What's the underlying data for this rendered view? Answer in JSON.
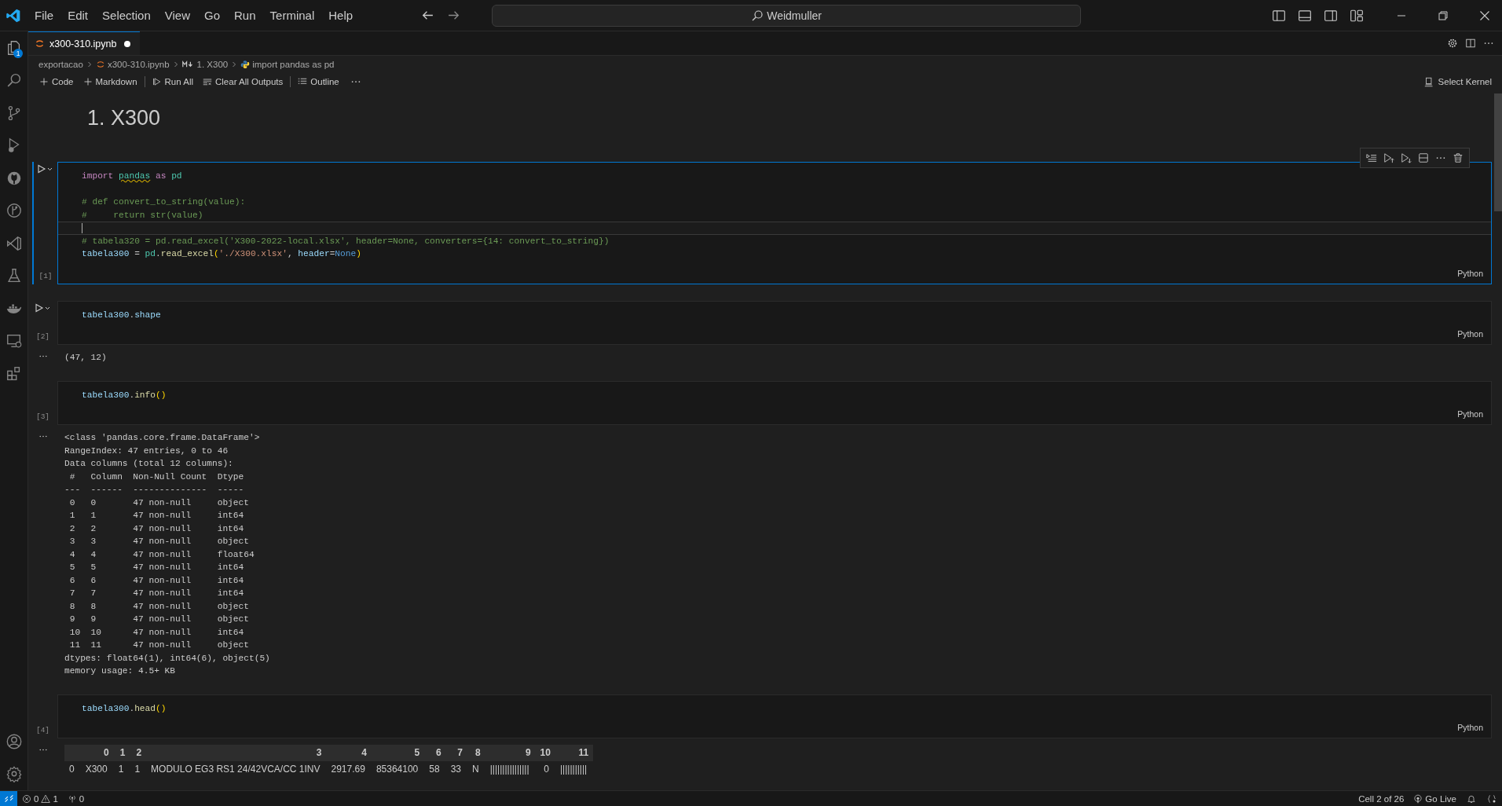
{
  "title_bar": {
    "menu": [
      "File",
      "Edit",
      "Selection",
      "View",
      "Go",
      "Run",
      "Terminal",
      "Help"
    ],
    "command_center": {
      "value": "Weidmuller"
    }
  },
  "activity_bar": {
    "top": [
      {
        "kind": "explorer",
        "badge": "1"
      },
      {
        "kind": "search"
      },
      {
        "kind": "source-control"
      },
      {
        "kind": "run-debug"
      },
      {
        "kind": "circle-logo"
      },
      {
        "kind": "git-graph"
      },
      {
        "kind": "ribbon"
      },
      {
        "kind": "testing"
      },
      {
        "kind": "docker"
      },
      {
        "kind": "remote"
      },
      {
        "kind": "extensions"
      }
    ],
    "bottom": [
      {
        "kind": "account"
      },
      {
        "kind": "manage"
      }
    ]
  },
  "tabs": [
    {
      "label": "x300-310.ipynb",
      "selected": true,
      "modified": true
    }
  ],
  "breadcrumbs": [
    {
      "kind": "folder",
      "label": "exportacao"
    },
    {
      "kind": "notebook",
      "label": "x300-310.ipynb"
    },
    {
      "kind": "markdown",
      "label": "1. X300"
    },
    {
      "kind": "python",
      "label": "import pandas as pd"
    }
  ],
  "notebook_toolbar": [
    {
      "kind": "add",
      "label": "Code"
    },
    {
      "kind": "add",
      "label": "Markdown"
    },
    {
      "kind": "separator"
    },
    {
      "kind": "run-all",
      "label": "Run All"
    },
    {
      "kind": "clear",
      "label": "Clear All Outputs"
    },
    {
      "kind": "separator"
    },
    {
      "kind": "outline",
      "label": "Outline"
    },
    {
      "kind": "more"
    }
  ],
  "kernel": {
    "label": "Select Kernel"
  },
  "heading": "1. X300",
  "cells": [
    {
      "selected": true,
      "run_visible": true,
      "toolbar_visible": true,
      "exec_count": "[1]",
      "language": "Python",
      "lines": [
        {
          "current": false,
          "tokens": [
            {
              "t": "import ",
              "kind": "keyword"
            },
            {
              "t": "pandas",
              "kind": "module-warn"
            },
            {
              "t": " as ",
              "kind": "keyword"
            },
            {
              "t": "pd",
              "kind": "module"
            }
          ]
        },
        {
          "current": false
        },
        {
          "current": false,
          "tokens": [
            {
              "t": "# def convert_to_string(value):",
              "kind": "comment"
            }
          ]
        },
        {
          "current": false,
          "tokens": [
            {
              "t": "#     return str(value)",
              "kind": "comment"
            }
          ]
        },
        {
          "current": true
        },
        {
          "current": false,
          "tokens": [
            {
              "t": "# tabela320 = pd.read_excel('X300-2022-local.xlsx', header=None, converters={14: convert_to_string})",
              "kind": "comment"
            }
          ]
        },
        {
          "current": false,
          "tokens": [
            {
              "t": "tabela300",
              "kind": "var"
            },
            {
              "t": " = ",
              "kind": "plain"
            },
            {
              "t": "pd",
              "kind": "module"
            },
            {
              "t": ".",
              "kind": "plain"
            },
            {
              "t": "read_excel",
              "kind": "func"
            },
            {
              "t": "(",
              "kind": "paren"
            },
            {
              "t": "'./X300.xlsx'",
              "kind": "string"
            },
            {
              "t": ", ",
              "kind": "plain"
            },
            {
              "t": "header",
              "kind": "param"
            },
            {
              "t": "=",
              "kind": "plain"
            },
            {
              "t": "None",
              "kind": "constant"
            },
            {
              "t": ")",
              "kind": "paren"
            }
          ]
        }
      ]
    },
    {
      "selected": false,
      "run_visible": true,
      "toolbar_visible": false,
      "exec_count": "[2]",
      "language": "Python",
      "lines": [
        {
          "current": false,
          "tokens": [
            {
              "t": "tabela300",
              "kind": "var"
            },
            {
              "t": ".",
              "kind": "plain"
            },
            {
              "t": "shape",
              "kind": "var"
            }
          ]
        }
      ],
      "output": {
        "kind": "text",
        "lines": [
          "(47, 12)"
        ]
      }
    },
    {
      "selected": false,
      "run_visible": false,
      "toolbar_visible": false,
      "exec_count": "[3]",
      "language": "Python",
      "lines": [
        {
          "current": false,
          "tokens": [
            {
              "t": "tabela300",
              "kind": "var"
            },
            {
              "t": ".",
              "kind": "plain"
            },
            {
              "t": "info",
              "kind": "func"
            },
            {
              "t": "()",
              "kind": "paren"
            }
          ]
        }
      ],
      "output": {
        "kind": "text",
        "lines": [
          "<class 'pandas.core.frame.DataFrame'>",
          "RangeIndex: 47 entries, 0 to 46",
          "Data columns (total 12 columns):",
          " #   Column  Non-Null Count  Dtype",
          "---  ------  --------------  -----",
          " 0   0       47 non-null     object",
          " 1   1       47 non-null     int64",
          " 2   2       47 non-null     int64",
          " 3   3       47 non-null     object",
          " 4   4       47 non-null     float64",
          " 5   5       47 non-null     int64",
          " 6   6       47 non-null     int64",
          " 7   7       47 non-null     int64",
          " 8   8       47 non-null     object",
          " 9   9       47 non-null     object",
          " 10  10      47 non-null     int64",
          " 11  11      47 non-null     object",
          "dtypes: float64(1), int64(6), object(5)",
          "memory usage: 4.5+ KB"
        ]
      }
    },
    {
      "selected": false,
      "run_visible": false,
      "toolbar_visible": false,
      "exec_count": "[4]",
      "language": "Python",
      "lines": [
        {
          "current": false,
          "tokens": [
            {
              "t": "tabela300",
              "kind": "var"
            },
            {
              "t": ".",
              "kind": "plain"
            },
            {
              "t": "head",
              "kind": "func"
            },
            {
              "t": "()",
              "kind": "paren"
            }
          ]
        }
      ],
      "output": {
        "kind": "table",
        "columns": [
          "0",
          "1",
          "2",
          "3",
          "4",
          "5",
          "6",
          "7",
          "8",
          "9",
          "10",
          "11"
        ],
        "rows": [
          {
            "index": "0",
            "cells": [
              "X300",
              "1",
              "1",
              "MODULO EG3 RS1 24/42VCA/CC 1INV",
              "2917.69",
              "85364100",
              "58",
              "33",
              "N",
              "||||||||||||||||",
              "0",
              "|||||||||||"
            ]
          }
        ]
      }
    }
  ],
  "status_bar": {
    "errors": "0",
    "warnings": "1",
    "ports": "0",
    "cell_position": "Cell 2 of 26",
    "go_live": "Go Live"
  }
}
